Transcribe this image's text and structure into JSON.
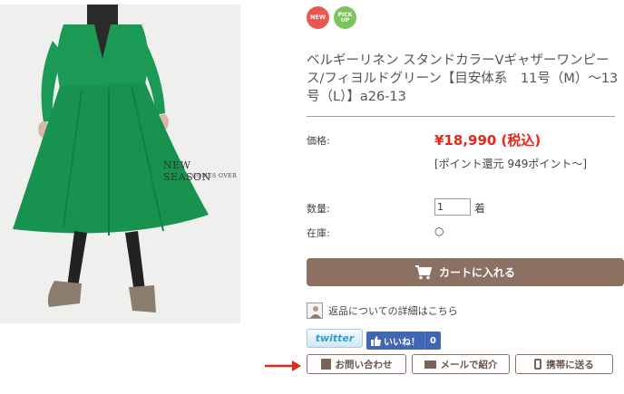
{
  "photo": {
    "new_season": "NEW SEASON",
    "comes_over": "COMES OVER"
  },
  "badges": {
    "new": "NEW",
    "pick_top": "PICK",
    "pick_bottom": "UP"
  },
  "product": {
    "title": "ベルギーリネン スタンドカラーVギャザーワンピース/フィヨルドグリーン【目安体系　11号（M）～13号（L）】a26-13",
    "price_label": "価格:",
    "price": "¥18,990 (税込)",
    "points": "[ポイント還元 949ポイント～]",
    "qty_label": "数量:",
    "qty_value": "1",
    "qty_unit": "着",
    "stock_label": "在庫:",
    "stock_value": "○"
  },
  "actions": {
    "cart": "カートに入れる",
    "return_info": "返品についての詳細はこちら",
    "twitter": "twitter",
    "like": "いいね！",
    "like_count": "0",
    "inquiry": "お問い合わせ",
    "mail": "メールで紹介",
    "mobile": "携帯に送る"
  },
  "colors": {
    "accent": "#8c7062",
    "price": "#e8261a",
    "dress": "#1a9a55"
  }
}
